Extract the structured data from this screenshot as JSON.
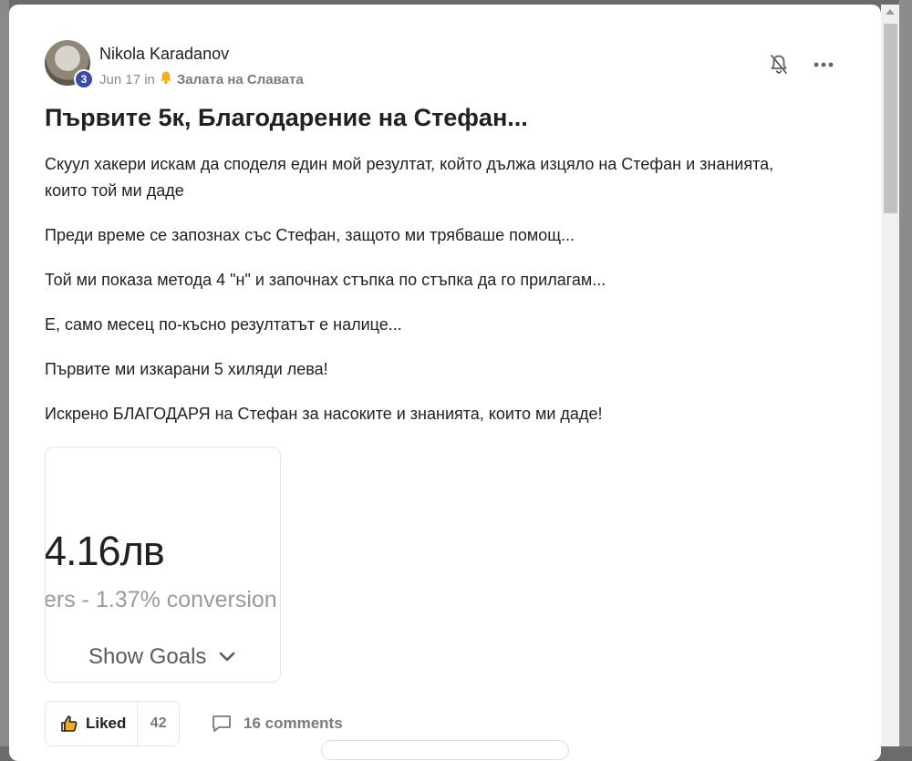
{
  "post": {
    "author": "Nikola Karadanov",
    "level": "3",
    "date": "Jun 17 in",
    "category_icon": "bell-emoji",
    "category": "Залата на Славата",
    "title": "Първите 5к, Благодарение на Стефан...",
    "paragraphs": [
      "Скуул хакери искам да споделя един мой резултат, който дължа изцяло на Стефан и знанията, които той ми даде",
      "Преди време се запознах със Стефан, защото ми трябваше помощ...",
      "Той ми показа метода 4 \"н\" и започнах стъпка по стъпка да го прилагам...",
      "Е, само месец по-късно резултатът е налице...",
      "Първите ми изкарани 5 хиляди лева!",
      "Искрено БЛАГОДАРЯ на Стефан за насоките и знанията, които ми даде!"
    ]
  },
  "attachment": {
    "amount": "4.16лв",
    "conversion": "ers - 1.37% conversion",
    "goals_label": "Show Goals"
  },
  "actions": {
    "like_label": "Liked",
    "like_count": "42",
    "comments_label": "16 comments"
  },
  "colors": {
    "level_badge": "#3e4aa8",
    "text": "#202124",
    "muted": "#8a8a8a"
  }
}
